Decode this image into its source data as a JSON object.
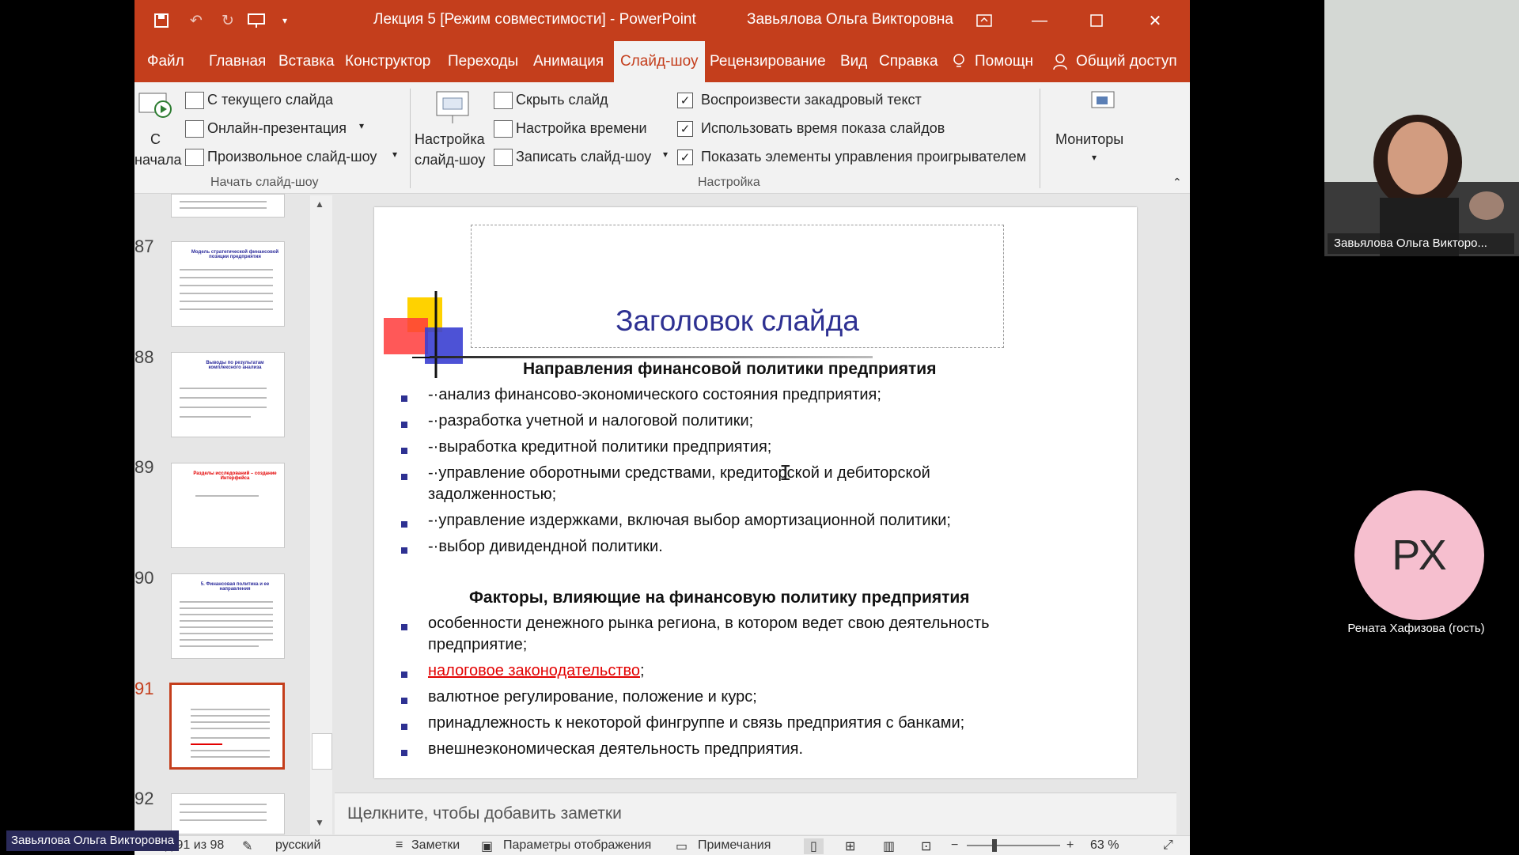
{
  "window": {
    "title": "Лекция 5 [Режим совместимости]  -  PowerPoint",
    "user": "Завьялова Ольга Викторовна"
  },
  "tabs": [
    "Файл",
    "Главная",
    "Вставка",
    "Конструктор",
    "Переходы",
    "Анимация",
    "Слайд-шоу",
    "Рецензирование",
    "Вид",
    "Справка",
    "Помощн",
    "Общий доступ"
  ],
  "ribbon": {
    "start": {
      "from_beginning_1": "С",
      "from_beginning_2": "начала",
      "from_current": "С текущего слайда",
      "online": "Онлайн-презентация",
      "custom": "Произвольное слайд-шоу",
      "group": "Начать слайд-шоу"
    },
    "setup": {
      "setup_1": "Настройка",
      "setup_2": "слайд-шоу",
      "hide": "Скрыть слайд",
      "timing": "Настройка времени",
      "record": "Записать слайд-шоу",
      "chk1": "Воспроизвести закадровый текст",
      "chk2": "Использовать время показа слайдов",
      "chk3": "Показать элементы управления проигрывателем",
      "group": "Настройка",
      "check": "✓"
    },
    "monitors": "Мониторы"
  },
  "thumbnails": [
    {
      "num": "87",
      "title": "Модель стратегической финансовой позиции предприятия"
    },
    {
      "num": "88",
      "title": "Выводы по результатам комплексного анализа"
    },
    {
      "num": "89",
      "title": "Разделы исследований – создание Интерфейса"
    },
    {
      "num": "90",
      "title": "5. Финансовая политика и ее направления"
    },
    {
      "num": "91",
      "title": ""
    },
    {
      "num": "92",
      "title": ""
    }
  ],
  "slide": {
    "title": "Заголовок слайда",
    "section1": "Направления финансовой политики предприятия",
    "items1": [
      "-·анализ финансово-экономического состояния предприятия;",
      "-·разработка учетной и налоговой политики;",
      "-·выработка кредитной политики предприятия;",
      "-·управление оборотными средствами, кредиторской и дебиторской задолженностью;",
      "-·управление издержками, включая выбор амортизационной политики;",
      "-·выбор дивидендной политики."
    ],
    "section2": "Факторы, влияющие на финансовую политику предприятия",
    "items2": [
      "особенности денежного рынка региона, в котором ведет свою деятельность предприятие;",
      "валютное регулирование, положение и курс;",
      "принадлежность к некоторой фингруппе и связь предприятия с банками;",
      "внешнеэкономическая деятельность предприятия."
    ],
    "link_item": "налоговое законодательство",
    "link_suffix": ";"
  },
  "notes_placeholder": "Щелкните, чтобы добавить заметки",
  "status": {
    "slide_info": "Слайд 91 из 98",
    "language": "русский",
    "notes": "Заметки",
    "display": "Параметры отображения",
    "comments": "Примечания",
    "zoom_minus": "−",
    "zoom_plus": "+",
    "zoom": "63 %",
    "zoom_level": 0.63
  },
  "meeting": {
    "presenter": "Завьялова Ольга Викторо...",
    "guest_initials": "РХ",
    "guest_name": "Рената Хафизова (гость)",
    "self_label": "Завьялова Ольга Викторовна"
  },
  "colors": {
    "accent": "#c43e1c",
    "title_blue": "#2e3192",
    "link_red": "#e30000",
    "avatar_pink": "#f6bfcf"
  }
}
